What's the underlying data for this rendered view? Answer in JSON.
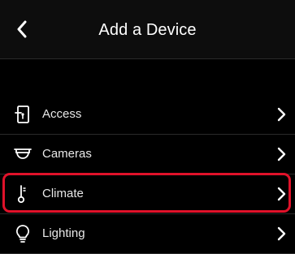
{
  "header": {
    "title": "Add a Device",
    "back_icon": "chevron-left-icon"
  },
  "devices": [
    {
      "label": "Access",
      "icon": "door-lock-icon"
    },
    {
      "label": "Cameras",
      "icon": "dome-camera-icon"
    },
    {
      "label": "Climate",
      "icon": "thermometer-icon",
      "highlighted": true
    },
    {
      "label": "Lighting",
      "icon": "lightbulb-icon"
    }
  ],
  "colors": {
    "background": "#000000",
    "header": "#0d0d0d",
    "highlight": "#e0122a"
  }
}
